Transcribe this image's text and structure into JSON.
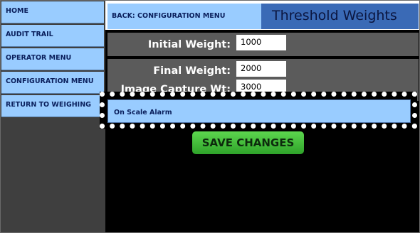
{
  "sidebar": {
    "items": [
      {
        "label": "HOME"
      },
      {
        "label": "AUDIT TRAIL"
      },
      {
        "label": "OPERATOR MENU"
      },
      {
        "label": "CONFIGURATION MENU"
      },
      {
        "label": "RETURN TO WEIGHING"
      }
    ]
  },
  "header": {
    "back_label": "BACK: CONFIGURATION MENU",
    "title": "Threshold Weights"
  },
  "fields": [
    {
      "label": "Initial Weight:",
      "value": "1000"
    },
    {
      "label": "Final Weight:",
      "value": "2000"
    },
    {
      "label": "Image Capture Wt:",
      "value": "3000"
    }
  ],
  "dragged_item": {
    "label": "On Scale Alarm"
  },
  "save_label": "SAVE CHANGES",
  "colors": {
    "nav_button": "#99ccff",
    "title_bar": "#3a6ab6",
    "row_background": "#5b5b5b",
    "save_button": "#3fbf3a"
  }
}
